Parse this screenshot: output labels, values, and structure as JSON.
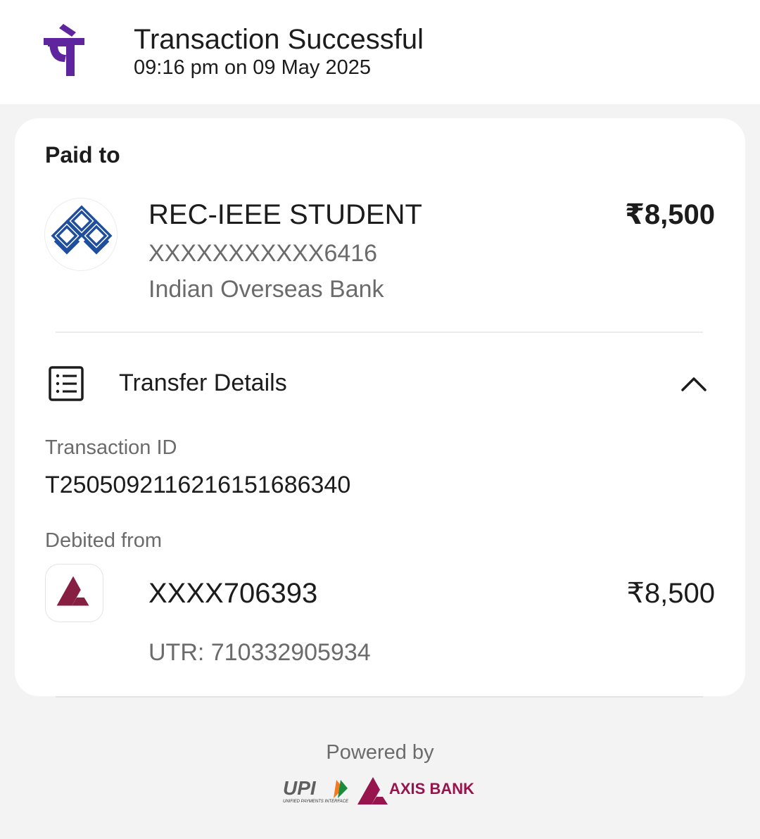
{
  "header": {
    "title": "Transaction Successful",
    "datetime": "09:16 pm on 09 May 2025",
    "brand_icon": "phonepe-logo",
    "brand_color": "#5f259f"
  },
  "paid_to": {
    "section_label": "Paid to",
    "payee_name": "REC-IEEE STUDENT",
    "payee_account": "XXXXXXXXXXX6416",
    "payee_bank": "Indian Overseas Bank",
    "amount": "₹8,500",
    "bank_icon": "indian-overseas-bank-logo",
    "bank_color": "#1f4e9e"
  },
  "transfer_details": {
    "label": "Transfer Details",
    "expanded": true,
    "icon": "receipt-list-icon",
    "transaction_id_label": "Transaction ID",
    "transaction_id": "T2505092116216151686340",
    "debited_from_label": "Debited from",
    "debit_account": "XXXX706393",
    "debit_amount": "₹8,500",
    "utr": "UTR: 710332905934",
    "debit_bank_icon": "axis-bank-logo"
  },
  "footer": {
    "powered_by": "Powered by",
    "upi_text": "UPI",
    "upi_tagline": "UNIFIED PAYMENTS INTERFACE",
    "axis_text": "AXIS BANK",
    "axis_color": "#97144d"
  }
}
